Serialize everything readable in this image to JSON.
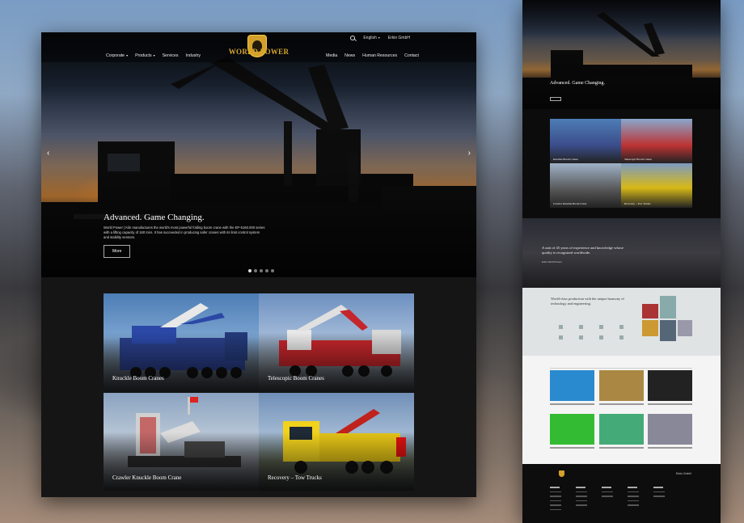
{
  "header": {
    "language": "English",
    "user_link": "Erkin GmbH",
    "brand_name": "WORLD POWER",
    "brand_crest": "ERKIN",
    "nav_left": [
      "Corporate",
      "Products",
      "Services",
      "Industry"
    ],
    "nav_right": [
      "Media",
      "News",
      "Human Resources",
      "Contact"
    ]
  },
  "hero": {
    "title": "Advanced. Game Changing.",
    "description": "World Power | Kiln manufactures the world's most powerful folding boom crane with the EP-5160.000 series with a lifting capacity of 160 tons. It has succeeded in producing safer cranes with its limit control system and stability sensors.",
    "more_label": "More",
    "slides": 5,
    "active_slide": 1
  },
  "categories": [
    {
      "label": "Knuckle Boom Cranes"
    },
    {
      "label": "Telescopic Boom Cranes"
    },
    {
      "label": "Crawler Knuckle Boom Crane"
    },
    {
      "label": "Recovery – Tow Trucks"
    }
  ],
  "side": {
    "hero_title": "Advanced. Game Changing.",
    "tiles": [
      "Knuckle Boom Cranes",
      "Telescopic Boom Cranes",
      "Crawler Knuckle Boom Crane",
      "Recovery – Tow Trucks"
    ],
    "quote": "A unit of 45 years of experience and knowledge whose quality is recognized worldwide.",
    "quote_sub": "Erkin World Power",
    "world_class": "World-class production with the unique harmony of technology and engineering.",
    "footer_brand": "Erkin GmbH"
  },
  "colors": {
    "gold": "#d3a12b",
    "dark": "#151515"
  }
}
